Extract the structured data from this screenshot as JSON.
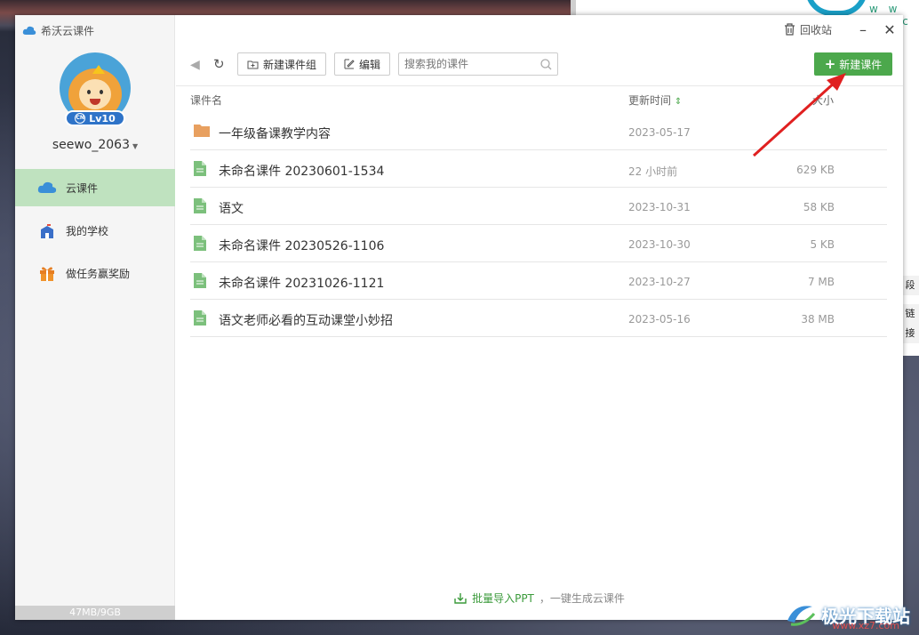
{
  "window": {
    "app_title": "希沃云课件"
  },
  "user": {
    "level": "Lv10",
    "username": "seewo_2063"
  },
  "sidebar": {
    "items": [
      {
        "label": "云课件",
        "icon": "cloud-icon",
        "active": true
      },
      {
        "label": "我的学校",
        "icon": "school-icon",
        "active": false
      },
      {
        "label": "做任务赢奖励",
        "icon": "gift-icon",
        "active": false
      }
    ],
    "storage": "47MB/9GB"
  },
  "titlebar": {
    "recycle_label": "回收站",
    "minimize": "–",
    "close": "✕"
  },
  "toolbar": {
    "new_group_label": "新建课件组",
    "edit_label": "编辑",
    "search_placeholder": "搜索我的课件",
    "new_courseware_label": "新建课件"
  },
  "table": {
    "columns": {
      "name": "课件名",
      "time": "更新时间",
      "sort_indicator": "⇕",
      "size": "大小"
    },
    "rows": [
      {
        "type": "folder",
        "name": "一年级备课教学内容",
        "time": "2023-05-17",
        "size": ""
      },
      {
        "type": "file",
        "name": "未命名课件 20230601-1534",
        "time": "22 小时前",
        "size": "629 KB"
      },
      {
        "type": "file",
        "name": "语文",
        "time": "2023-10-31",
        "size": "58 KB"
      },
      {
        "type": "file",
        "name": "未命名课件 20230526-1106",
        "time": "2023-10-30",
        "size": "5 KB"
      },
      {
        "type": "file",
        "name": "未命名课件 20231026-1121",
        "time": "2023-10-27",
        "size": "7 MB"
      },
      {
        "type": "file",
        "name": "语文老师必看的互动课堂小妙招",
        "time": "2023-05-16",
        "size": "38 MB"
      }
    ]
  },
  "footer": {
    "import_link": "批量导入PPT",
    "import_suffix": "，一键生成云课件"
  },
  "background": {
    "right_window_url": "w w w . c",
    "right_window_side_1": "段",
    "right_window_side_2": "链接",
    "watermark": "极光下载站",
    "watermark_url": "www.xz7.com"
  },
  "colors": {
    "accent_green": "#4ca84c",
    "active_nav": "#bfe2bf",
    "annotation_red": "#e02020"
  }
}
